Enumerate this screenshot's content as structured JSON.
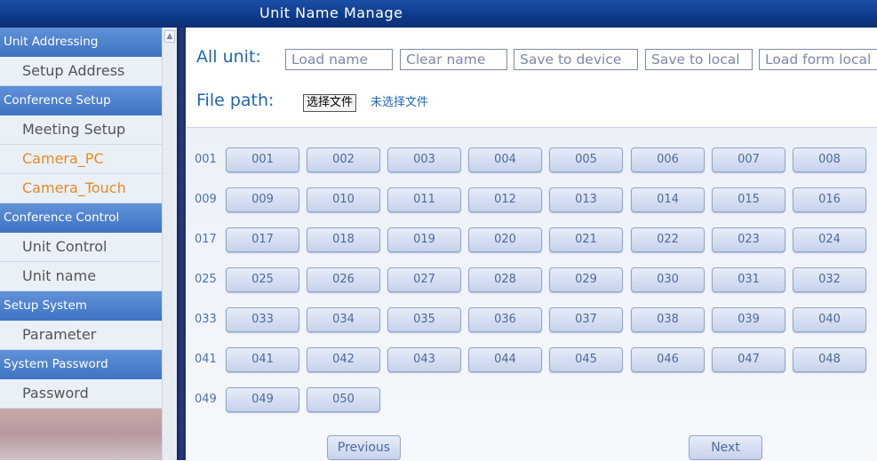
{
  "window": {
    "title": "Unit Name Manage"
  },
  "sidebar": {
    "sections": [
      {
        "header": "Unit Addressing",
        "items": [
          {
            "label": "Setup Address",
            "highlight": false
          }
        ]
      },
      {
        "header": "Conference Setup",
        "items": [
          {
            "label": "Meeting Setup",
            "highlight": false
          },
          {
            "label": "Camera_PC",
            "highlight": true
          },
          {
            "label": "Camera_Touch",
            "highlight": true
          }
        ]
      },
      {
        "header": "Conference Control",
        "items": [
          {
            "label": "Unit Control",
            "highlight": false
          },
          {
            "label": "Unit name",
            "highlight": false
          }
        ]
      },
      {
        "header": "Setup System",
        "items": [
          {
            "label": "Parameter",
            "highlight": false
          }
        ]
      },
      {
        "header": "System Password",
        "items": [
          {
            "label": "Password",
            "highlight": false
          }
        ]
      }
    ]
  },
  "toolbar": {
    "all_unit_label": "All unit:",
    "buttons": [
      "Load name",
      "Clear name",
      "Save to device",
      "Save to local",
      "Load form local"
    ]
  },
  "file": {
    "label": "File path:",
    "choose_button": "选择文件",
    "status": "未选择文件"
  },
  "grid": {
    "rows": [
      {
        "label": "001",
        "units": [
          "001",
          "002",
          "003",
          "004",
          "005",
          "006",
          "007",
          "008"
        ]
      },
      {
        "label": "009",
        "units": [
          "009",
          "010",
          "011",
          "012",
          "013",
          "014",
          "015",
          "016"
        ]
      },
      {
        "label": "017",
        "units": [
          "017",
          "018",
          "019",
          "020",
          "021",
          "022",
          "023",
          "024"
        ]
      },
      {
        "label": "025",
        "units": [
          "025",
          "026",
          "027",
          "028",
          "029",
          "030",
          "031",
          "032"
        ]
      },
      {
        "label": "033",
        "units": [
          "033",
          "034",
          "035",
          "036",
          "037",
          "038",
          "039",
          "040"
        ]
      },
      {
        "label": "041",
        "units": [
          "041",
          "042",
          "043",
          "044",
          "045",
          "046",
          "047",
          "048"
        ]
      },
      {
        "label": "049",
        "units": [
          "049",
          "050"
        ]
      }
    ]
  },
  "pager": {
    "previous": "Previous",
    "next": "Next"
  },
  "colors": {
    "title_bar": "#0d3a8a",
    "sidebar_header": "#4a7fcb",
    "accent_text": "#1d66b7",
    "highlight_item": "#e98a1e"
  }
}
